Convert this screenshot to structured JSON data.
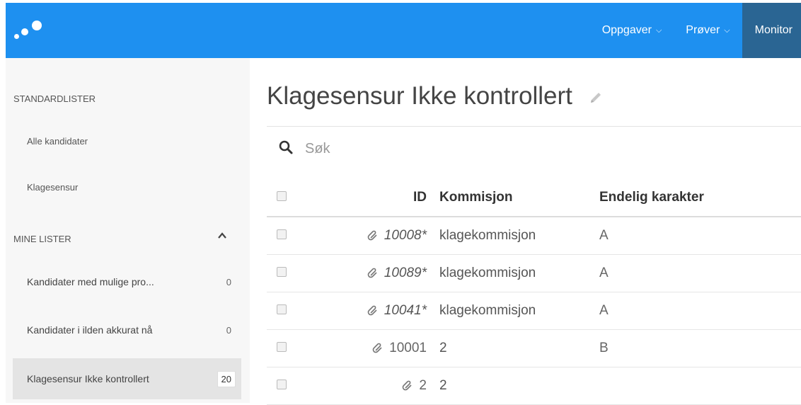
{
  "header": {
    "nav": [
      {
        "label": "Oppgaver",
        "has_dropdown": true
      },
      {
        "label": "Prøver",
        "has_dropdown": true
      },
      {
        "label": "Monitor",
        "active": true
      }
    ],
    "brand_color": "#1e90f0",
    "active_color": "#2a6593"
  },
  "sidebar": {
    "standard_heading": "STANDARDLISTER",
    "standard_items": [
      "Alle kandidater",
      "Klagesensur"
    ],
    "my_heading": "MINE LISTER",
    "my_items": [
      {
        "label": "Kandidater med mulige pro...",
        "count": "0"
      },
      {
        "label": "Kandidater i ilden akkurat nå",
        "count": "0"
      },
      {
        "label": "Klagesensur Ikke kontrollert",
        "count": "20",
        "active": true
      }
    ]
  },
  "main": {
    "title": "Klagesensur Ikke kontrollert",
    "search_placeholder": "Søk",
    "columns": [
      "ID",
      "Kommisjon",
      "Endelig karakter"
    ],
    "rows": [
      {
        "id": "10008*",
        "italic": true,
        "kommisjon": "klagekommisjon",
        "karakter": "A"
      },
      {
        "id": "10089*",
        "italic": true,
        "kommisjon": "klagekommisjon",
        "karakter": "A"
      },
      {
        "id": "10041*",
        "italic": true,
        "kommisjon": "klagekommisjon",
        "karakter": "A"
      },
      {
        "id": "10001",
        "italic": false,
        "kommisjon": "2",
        "karakter": "B"
      },
      {
        "id": "2",
        "italic": false,
        "kommisjon": "2",
        "karakter": ""
      }
    ]
  }
}
